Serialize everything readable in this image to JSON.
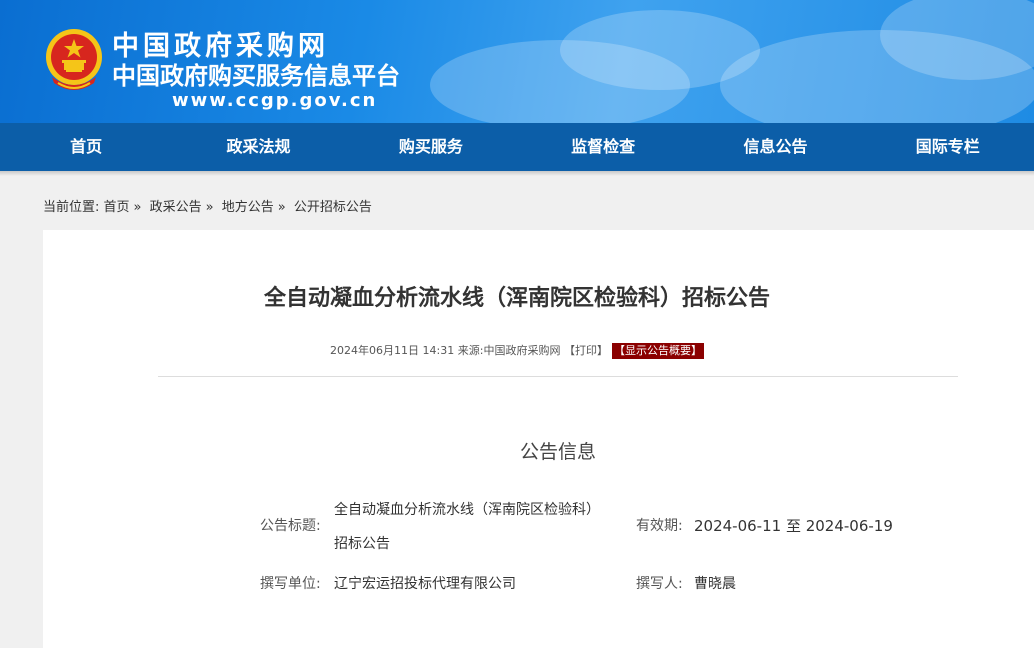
{
  "header": {
    "site_name": "中国政府采购网",
    "site_subtitle": "中国政府购买服务信息平台",
    "url": "www.ccgp.gov.cn"
  },
  "nav": {
    "items": [
      "首页",
      "政采法规",
      "购买服务",
      "监督检查",
      "信息公告",
      "国际专栏"
    ]
  },
  "breadcrumb": {
    "prefix": "当前位置:",
    "items": [
      "首页",
      "政采公告",
      "地方公告",
      "公开招标公告"
    ],
    "separator": "»"
  },
  "article": {
    "title": "全自动凝血分析流水线（浑南院区检验科）招标公告",
    "datetime": "2024年06月11日 14:31",
    "source_label": "来源:",
    "source": "中国政府采购网",
    "print_label": "【打印】",
    "summary_label": "【显示公告概要】"
  },
  "info": {
    "section_title": "公告信息",
    "title_label": "公告标题:",
    "title_value_line1": "全自动凝血分析流水线（浑南院区检验科）",
    "title_value_line2": "招标公告",
    "validity_label": "有效期:",
    "validity_value": "2024-06-11 至 2024-06-19",
    "unit_label": "撰写单位:",
    "unit_value": "辽宁宏运招投标代理有限公司",
    "writer_label": "撰写人:",
    "writer_value": "曹晓晨"
  },
  "colors": {
    "header_blue": "#1a8ae6",
    "nav_blue": "#0c5ea8",
    "summary_red": "#8b0000",
    "emblem_red": "#d7261e",
    "emblem_gold": "#f5c518"
  }
}
